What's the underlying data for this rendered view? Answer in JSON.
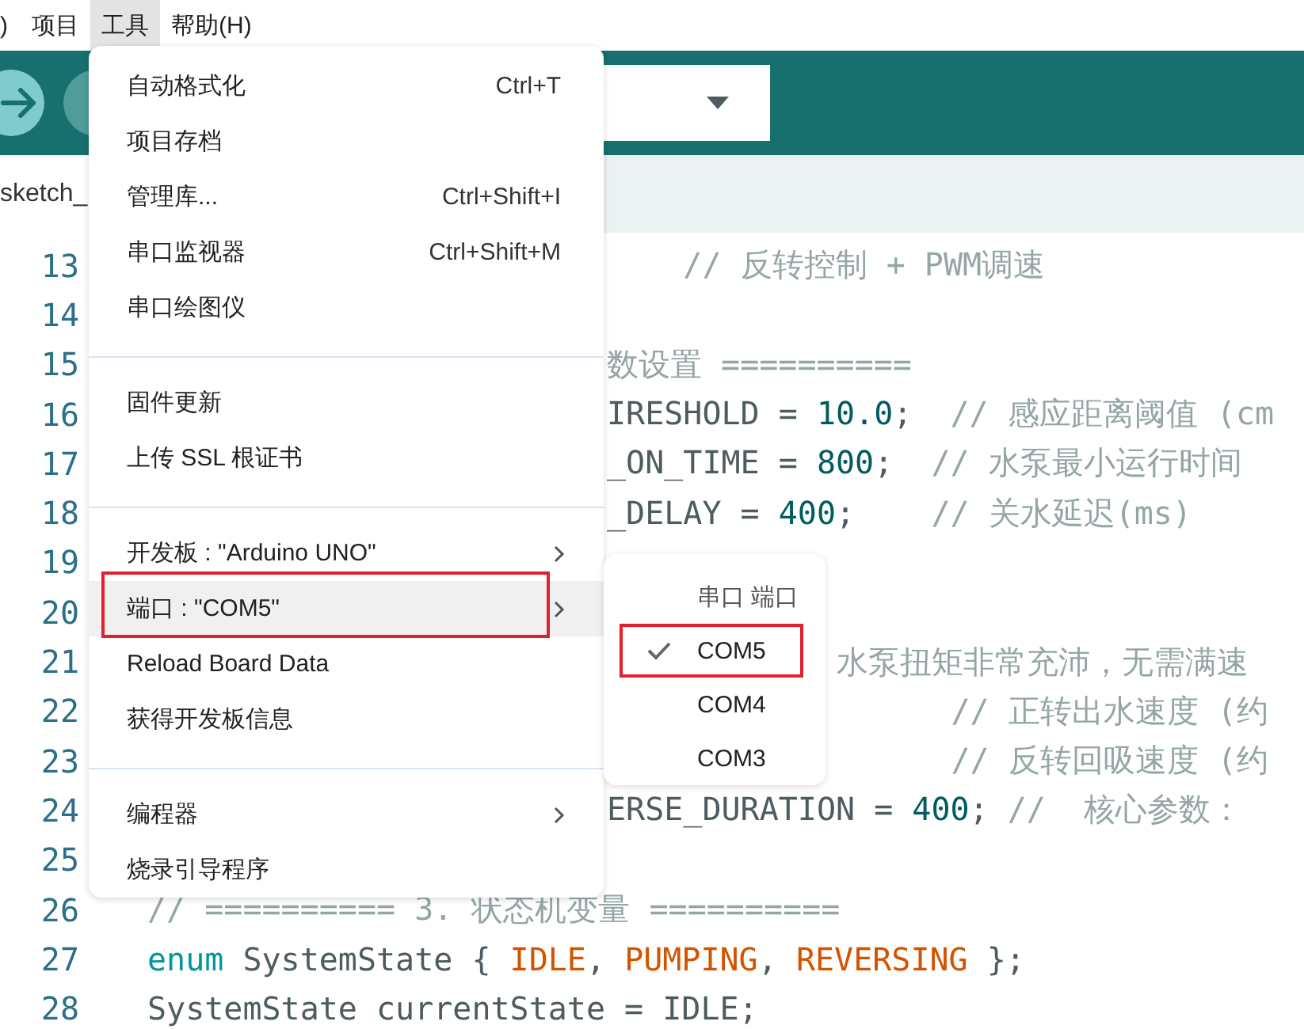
{
  "menu_bar": [
    {
      "label": ")",
      "selected": false
    },
    {
      "label": "项目",
      "selected": false
    },
    {
      "label": "工具",
      "selected": true
    },
    {
      "label": "帮助(H)",
      "selected": false
    }
  ],
  "tab": {
    "label": "sketch_"
  },
  "code_lines": [
    {
      "number": "13",
      "kind": "after_menu",
      "tokens": [
        {
          "kind": "comment",
          "t": "    // 反转控制 + PWM调速"
        }
      ]
    },
    {
      "number": "14"
    },
    {
      "number": "15",
      "kind": "after_menu",
      "tokens": [
        {
          "kind": "comment",
          "t": "数设置 =========="
        }
      ]
    },
    {
      "number": "16",
      "kind": "after_menu",
      "tokens": [
        {
          "kind": "plain",
          "t": "IRESHOLD = "
        },
        {
          "kind": "number",
          "t": "10.0"
        },
        {
          "kind": "plain",
          "t": ";  "
        },
        {
          "kind": "comment",
          "t": "// 感应距离阈值 (cm"
        }
      ]
    },
    {
      "number": "17",
      "kind": "after_menu",
      "tokens": [
        {
          "kind": "plain",
          "t": "_ON_TIME = "
        },
        {
          "kind": "number",
          "t": "800"
        },
        {
          "kind": "plain",
          "t": ";  "
        },
        {
          "kind": "comment",
          "t": "// 水泵最小运行时间"
        }
      ]
    },
    {
      "number": "18",
      "kind": "after_menu",
      "tokens": [
        {
          "kind": "plain",
          "t": "_DELAY = "
        },
        {
          "kind": "number",
          "t": "400"
        },
        {
          "kind": "plain",
          "t": ";    "
        },
        {
          "kind": "comment",
          "t": "// 关水延迟(ms)"
        }
      ]
    },
    {
      "number": "19"
    },
    {
      "number": "20"
    },
    {
      "number": "21",
      "kind": "after_submenu",
      "tokens": [
        {
          "kind": "comment",
          "t": "水泵扭矩非常充沛，无需满速"
        }
      ]
    },
    {
      "number": "22",
      "kind": "after_submenu",
      "tokens": [
        {
          "kind": "comment",
          "t": "      // 正转出水速度 (约"
        }
      ]
    },
    {
      "number": "23",
      "kind": "after_submenu",
      "tokens": [
        {
          "kind": "comment",
          "t": "      // 反转回吸速度 (约"
        }
      ]
    },
    {
      "number": "24",
      "kind": "after_menu",
      "tokens": [
        {
          "kind": "plain",
          "t": "ERSE_DURATION = "
        },
        {
          "kind": "number",
          "t": "400"
        },
        {
          "kind": "plain",
          "t": "; "
        },
        {
          "kind": "comment",
          "t": "//  核心参数："
        }
      ]
    },
    {
      "number": "25"
    },
    {
      "number": "26",
      "kind": "full",
      "tokens": [
        {
          "kind": "comment",
          "t": "// ========== 3. 状态机变量 =========="
        }
      ]
    },
    {
      "number": "27",
      "kind": "full",
      "tokens": [
        {
          "kind": "keyword",
          "t": "enum"
        },
        {
          "kind": "plain",
          "t": " SystemState { "
        },
        {
          "kind": "constant",
          "t": "IDLE"
        },
        {
          "kind": "plain",
          "t": ", "
        },
        {
          "kind": "constant",
          "t": "PUMPING"
        },
        {
          "kind": "plain",
          "t": ", "
        },
        {
          "kind": "constant",
          "t": "REVERSING"
        },
        {
          "kind": "plain",
          "t": " };"
        }
      ]
    },
    {
      "number": "28",
      "kind": "full",
      "tokens": [
        {
          "kind": "plain",
          "t": "SystemState currentState = IDLE;"
        }
      ]
    }
  ],
  "menu": {
    "groups": [
      [
        {
          "label": "自动格式化",
          "shortcut": "Ctrl+T",
          "submenu": false,
          "selected": false,
          "highlighted": false
        },
        {
          "label": "项目存档",
          "submenu": false,
          "selected": false,
          "highlighted": false
        },
        {
          "label": "管理库...",
          "shortcut": "Ctrl+Shift+I",
          "submenu": false,
          "selected": false,
          "highlighted": false
        },
        {
          "label": "串口监视器",
          "shortcut": "Ctrl+Shift+M",
          "submenu": false,
          "selected": false,
          "highlighted": false
        },
        {
          "label": "串口绘图仪",
          "submenu": false,
          "selected": false,
          "highlighted": false
        }
      ],
      [
        {
          "label": "固件更新",
          "submenu": false,
          "selected": false,
          "highlighted": false
        },
        {
          "label": "上传 SSL 根证书",
          "submenu": false,
          "selected": false,
          "highlighted": false
        }
      ],
      [
        {
          "label": "开发板 : \"Arduino UNO\"",
          "submenu": true,
          "selected": false,
          "highlighted": false
        },
        {
          "label": "端口 : \"COM5\"",
          "submenu": true,
          "selected": true,
          "highlighted": true
        },
        {
          "label": "Reload Board Data",
          "submenu": false,
          "selected": false,
          "highlighted": false
        },
        {
          "label": "获得开发板信息",
          "submenu": false,
          "selected": false,
          "highlighted": false
        }
      ],
      [
        {
          "label": "编程器",
          "submenu": true,
          "selected": false,
          "highlighted": false
        },
        {
          "label": "烧录引导程序",
          "submenu": false,
          "selected": false,
          "highlighted": false
        }
      ]
    ]
  },
  "submenu": {
    "items": [
      {
        "kind": "header",
        "label": "串口 端口"
      },
      {
        "kind": "option",
        "label": "COM5",
        "checked": true,
        "highlighted": true
      },
      {
        "kind": "option",
        "label": "COM4",
        "checked": false,
        "highlighted": false
      },
      {
        "kind": "option",
        "label": "COM3",
        "checked": false,
        "highlighted": false
      }
    ]
  }
}
